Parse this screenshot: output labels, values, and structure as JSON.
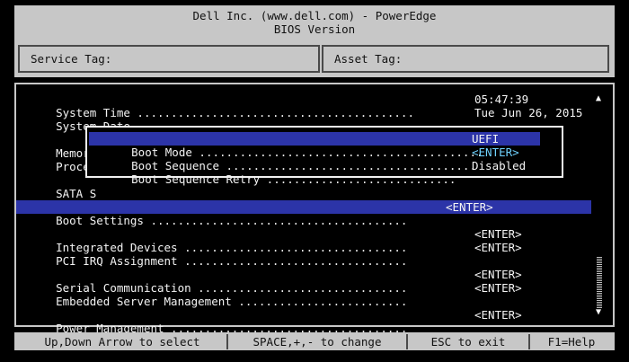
{
  "header": {
    "line1": "Dell Inc. (www.dell.com) - PowerEdge",
    "line2": "BIOS Version"
  },
  "tags": {
    "service_label": "Service Tag:",
    "asset_label": "Asset Tag:"
  },
  "main": {
    "items": [
      {
        "label": "System Time",
        "dots": " .........................................",
        "value": "05:47:39"
      },
      {
        "label": "System Date",
        "dots": " .........................................",
        "value": "Tue Jun 26, 2015"
      },
      {
        "label": "Memory",
        "dots": "",
        "value": ""
      },
      {
        "label": "Proces",
        "dots": "",
        "value": ""
      },
      {
        "label": "SATA S",
        "dots": "",
        "value": ""
      },
      {
        "label": "Boot Settings",
        "dots": " ......................................",
        "value": "<ENTER>"
      },
      {
        "label": "Integrated Devices",
        "dots": " .................................",
        "value": "<ENTER>"
      },
      {
        "label": "PCI IRQ Assignment",
        "dots": " .................................",
        "value": "<ENTER>"
      },
      {
        "label": "Serial Communication",
        "dots": " ...............................",
        "value": "<ENTER>"
      },
      {
        "label": "Embedded Server Management",
        "dots": " .........................",
        "value": "<ENTER>"
      },
      {
        "label": "Power Management",
        "dots": " ...................................",
        "value": "<ENTER>"
      }
    ]
  },
  "popup": {
    "items": [
      {
        "label": "Boot Mode",
        "dots": " ..........................................",
        "value": "UEFI"
      },
      {
        "label": "Boot Sequence",
        "dots": " .....................................",
        "value": "<ENTER>"
      },
      {
        "label": "Boot Sequence Retry",
        "dots": " ............................",
        "value": "Disabled"
      }
    ]
  },
  "footer": {
    "hint1": "Up,Down Arrow to select",
    "hint2": "SPACE,+,- to change",
    "hint3": "ESC to exit",
    "hint4": "F1=Help"
  },
  "colors": {
    "highlight": "#2c34a8",
    "chrome": "#c7c7c7",
    "link": "#6fd3ff"
  }
}
